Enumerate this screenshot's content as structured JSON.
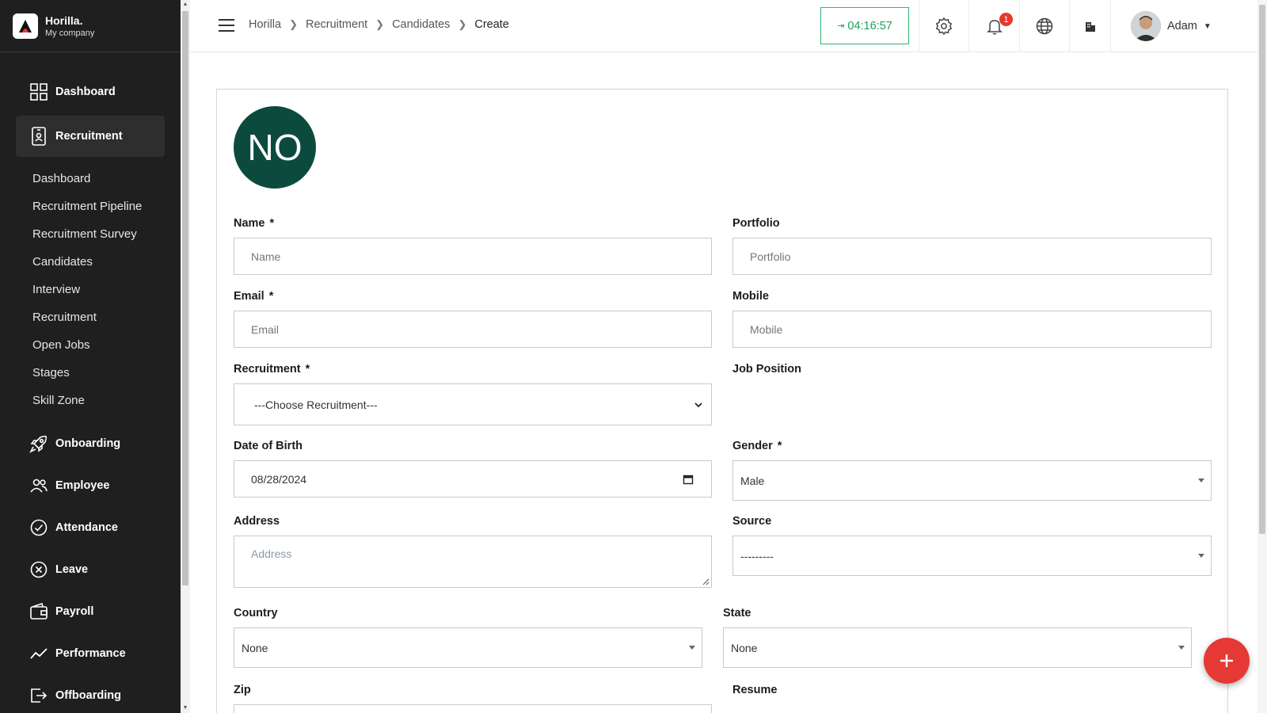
{
  "brand": {
    "name": "Horilla.",
    "company": "My company"
  },
  "sidebar": {
    "items": [
      {
        "label": "Dashboard",
        "icon": "grid-icon"
      },
      {
        "label": "Recruitment",
        "icon": "recruitment-icon",
        "active": true
      },
      {
        "label": "Onboarding",
        "icon": "rocket-icon"
      },
      {
        "label": "Employee",
        "icon": "people-icon"
      },
      {
        "label": "Attendance",
        "icon": "check-circle-icon"
      },
      {
        "label": "Leave",
        "icon": "x-circle-icon"
      },
      {
        "label": "Payroll",
        "icon": "wallet-icon"
      },
      {
        "label": "Performance",
        "icon": "trend-icon"
      },
      {
        "label": "Offboarding",
        "icon": "exit-icon"
      }
    ],
    "subitems": [
      "Dashboard",
      "Recruitment Pipeline",
      "Recruitment Survey",
      "Candidates",
      "Interview",
      "Recruitment",
      "Open Jobs",
      "Stages",
      "Skill Zone"
    ]
  },
  "header": {
    "breadcrumb": [
      "Horilla",
      "Recruitment",
      "Candidates",
      "Create"
    ],
    "timer": "04:16:57",
    "notification_count": "1",
    "user_name": "Adam"
  },
  "form": {
    "initials": "NO",
    "name": {
      "label": "Name",
      "required": "*",
      "placeholder": "Name"
    },
    "portfolio": {
      "label": "Portfolio",
      "placeholder": "Portfolio"
    },
    "email": {
      "label": "Email",
      "required": "*",
      "placeholder": "Email"
    },
    "mobile": {
      "label": "Mobile",
      "placeholder": "Mobile"
    },
    "recruitment": {
      "label": "Recruitment",
      "required": "*",
      "value": "---Choose Recruitment---"
    },
    "job_position": {
      "label": "Job Position"
    },
    "dob": {
      "label": "Date of Birth",
      "value": "08/28/2024"
    },
    "gender": {
      "label": "Gender",
      "required": "*",
      "value": "Male"
    },
    "address": {
      "label": "Address",
      "placeholder": "Address"
    },
    "source": {
      "label": "Source",
      "value": "---------"
    },
    "country": {
      "label": "Country",
      "value": "None"
    },
    "state": {
      "label": "State",
      "value": "None"
    },
    "zip": {
      "label": "Zip"
    },
    "resume": {
      "label": "Resume"
    }
  },
  "colors": {
    "sidebar_bg": "#1f1f1f",
    "accent_green": "#0d4a3e",
    "timer_green": "#1ea160",
    "fab_red": "#e53935"
  }
}
